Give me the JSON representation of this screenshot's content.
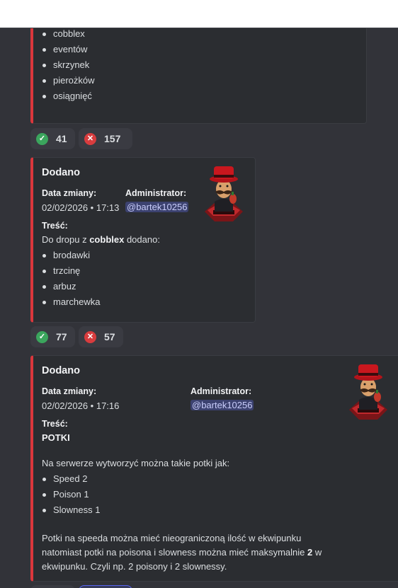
{
  "colors": {
    "accent_bar": "#da373c",
    "mention_bg": "#3c4270",
    "check": "#3ba55d",
    "cross": "#d83c3e"
  },
  "embed1": {
    "items": [
      "cobblex",
      "eventów",
      "skrzynek",
      "pierożków",
      "osiągnięć"
    ]
  },
  "reactions1": [
    {
      "icon": "check-icon",
      "count": "41"
    },
    {
      "icon": "cross-icon",
      "count": "157"
    }
  ],
  "embed2": {
    "title": "Dodano",
    "date_label": "Data zmiany:",
    "date_value": "02/02/2026 • 17:13",
    "admin_label": "Administrator:",
    "admin_value": "@bartek10256",
    "content_label": "Treść:",
    "intro_prefix": "Do dropu z ",
    "intro_bold": "cobblex",
    "intro_suffix": " dodano:",
    "items": [
      "brodawki",
      "trzcinę",
      "arbuz",
      "marchewka"
    ],
    "thumbnail_icon": "mustache-man-avatar-icon"
  },
  "reactions2": [
    {
      "icon": "check-icon",
      "count": "77"
    },
    {
      "icon": "cross-icon",
      "count": "57"
    }
  ],
  "embed3": {
    "title": "Dodano",
    "date_label": "Data zmiany:",
    "date_value": "02/02/2026 • 17:16",
    "admin_label": "Administrator:",
    "admin_value": "@bartek10256",
    "content_label": "Treść:",
    "heading": "POTKI",
    "intro": "Na serwerze wytworzyć można takie potki jak:",
    "items": [
      "Speed 2",
      "Poison 1",
      "Slowness 1"
    ],
    "para_line1": "Potki na speeda można mieć nieograniczoną ilość w ekwipunku",
    "para_line2_prefix": "natomiast potki na poisona i slowness można mieć maksymalnie ",
    "para_line2_bold": "2",
    "para_line2_suffix": " w",
    "para_line3": "ekwipunku. Czyli np. 2 poisony i 2 slownessy.",
    "thumbnail_icon": "mustache-man-avatar-icon"
  }
}
